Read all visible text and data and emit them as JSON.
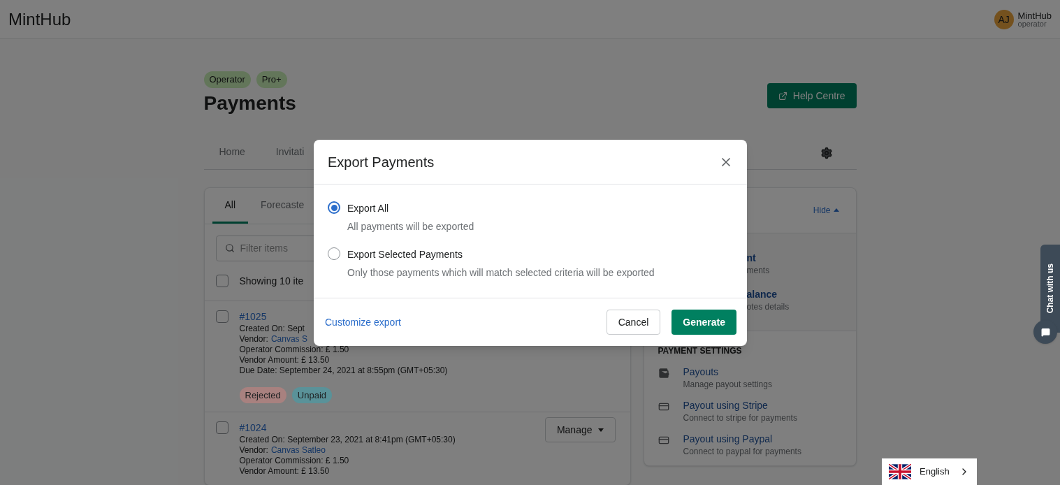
{
  "header": {
    "brand": "MintHub",
    "user": {
      "initials": "AJ",
      "name": "MintHub",
      "role": "operator"
    }
  },
  "page": {
    "badges": [
      "Operator",
      "Pro+"
    ],
    "title": "Payments",
    "help_button": "Help Centre"
  },
  "nav_tabs": [
    {
      "label": "Home",
      "selected": false
    },
    {
      "label": "Invitati",
      "selected": false
    }
  ],
  "list_card": {
    "tabs": [
      {
        "label": "All",
        "selected": true
      },
      {
        "label": "Forecaste",
        "selected": false
      }
    ],
    "filter": {
      "placeholder": "Filter items"
    },
    "select_all": {
      "label": "Showing 10 ite",
      "checked": false
    },
    "payments": [
      {
        "number": "#1025",
        "checked": false,
        "lines": [
          {
            "kind": "text",
            "text": "Created On: Sept"
          },
          {
            "kind": "vendor",
            "label": "Vendor:",
            "link": "Canvas S"
          },
          {
            "kind": "text",
            "text": "Operator Commission: £ 1.50"
          },
          {
            "kind": "text",
            "text": "Vendor Amount: £ 13.50"
          },
          {
            "kind": "text",
            "text": "Due Date: September 24, 2021 at 8:55pm (GMT+05:30)"
          }
        ],
        "tags": [
          {
            "label": "Rejected",
            "color": "#a8817f"
          },
          {
            "label": "Unpaid",
            "color": "#5a9299"
          }
        ]
      },
      {
        "number": "#1024",
        "checked": false,
        "manage_button": "Manage",
        "lines": [
          {
            "kind": "text",
            "text": "Created On: September 23, 2021 at 8:41pm (GMT+05:30)"
          },
          {
            "kind": "vendor",
            "label": "Vendor:",
            "link": "Canvas Satleo"
          },
          {
            "kind": "text",
            "text": "Operator Commission: £ 1.50"
          },
          {
            "kind": "text",
            "text": "Vendor Amount: £ 13.50"
          }
        ]
      }
    ]
  },
  "side_card": {
    "hide_link": "Hide",
    "overview_items": [
      {
        "title": "nt",
        "description": "ments"
      },
      {
        "title": "alance",
        "description": "otes details"
      }
    ],
    "settings_heading": "PAYMENT SETTINGS",
    "settings_items": [
      {
        "kind": "wallet",
        "title": "Payouts",
        "description": "Manage payout settings"
      },
      {
        "kind": "card",
        "title": "Payout using Stripe",
        "description": "Connect to stripe for payments"
      },
      {
        "kind": "card",
        "title": "Payout using Paypal",
        "description": "Connect to paypal for payments"
      }
    ]
  },
  "modal": {
    "title": "Export Payments",
    "options": [
      {
        "label": "Export All",
        "description": "All payments will be exported",
        "selected": true
      },
      {
        "label": "Export Selected Payments",
        "description": "Only those payments which will match selected criteria will be exported",
        "selected": false
      }
    ],
    "customize_link": "Customize export",
    "buttons": [
      {
        "kind": "secondary",
        "label": "Cancel"
      },
      {
        "kind": "primary",
        "label": "Generate"
      }
    ]
  },
  "chat_widget": {
    "label": "Chat with us"
  },
  "language": {
    "label": "English"
  }
}
